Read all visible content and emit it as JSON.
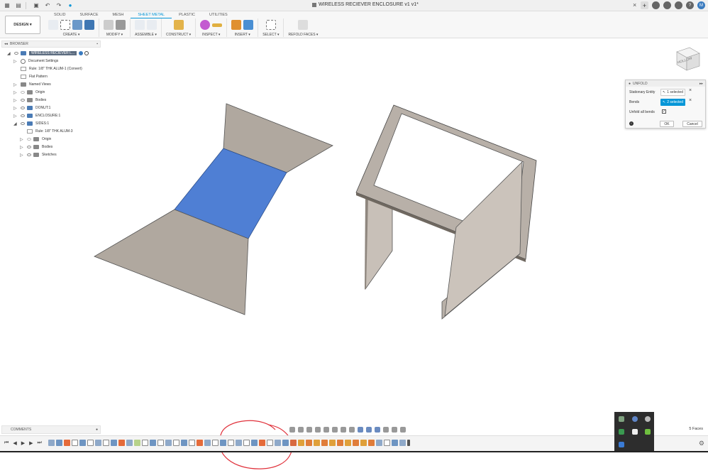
{
  "app": {
    "document_title": "WIRELESS RECIEVER ENCLOSURE v1 v1*"
  },
  "ribbon": {
    "tabs": [
      "SOLID",
      "SURFACE",
      "MESH",
      "SHEET METAL",
      "PLASTIC",
      "UTILITIES"
    ],
    "active_tab": "SHEET METAL",
    "workspace_button": "DESIGN ▾",
    "groups": [
      "CREATE ▾",
      "MODIFY ▾",
      "ASSEMBLE ▾",
      "CONSTRUCT ▾",
      "INSPECT ▾",
      "INSERT ▾",
      "SELECT ▾",
      "REFOLD FACES ▾"
    ]
  },
  "browser": {
    "header": "BROWSER",
    "items": [
      {
        "label": "WIRELESS RECIEVER L..."
      },
      {
        "label": "Document Settings"
      },
      {
        "label": "Rule: 1/8\" THK ALUM-1 (Convert)"
      },
      {
        "label": "Flat Pattern"
      },
      {
        "label": "Named Views"
      },
      {
        "label": "Origin"
      },
      {
        "label": "Bodies"
      },
      {
        "label": "DONUT:1"
      },
      {
        "label": "ENCLOSURE:1"
      },
      {
        "label": "SIDES:1"
      },
      {
        "label": "Rule: 1/8\" THK ALUM-3"
      },
      {
        "label": "Origin"
      },
      {
        "label": "Bodies"
      },
      {
        "label": "Sketches"
      }
    ]
  },
  "unfold_dialog": {
    "title": "UNFOLD",
    "stationary_entity_label": "Stationary Entity",
    "stationary_entity_value": "1 selected",
    "bends_label": "Bends",
    "bends_value": "2 selected",
    "unfold_all_bends_label": "Unfold all bends",
    "unfold_all_bends_checked": true,
    "ok_label": "OK",
    "cancel_label": "Cancel"
  },
  "viewcube": {
    "face_label": "HOLLOW"
  },
  "comments": {
    "label": "COMMENTS"
  },
  "status": {
    "selection": "5 Faces"
  },
  "colors": {
    "accent": "#0696d7",
    "selected_face": "#4f7fd4",
    "sheet_metal": "#b0a89f",
    "annotation_circle": "#e0303a"
  }
}
